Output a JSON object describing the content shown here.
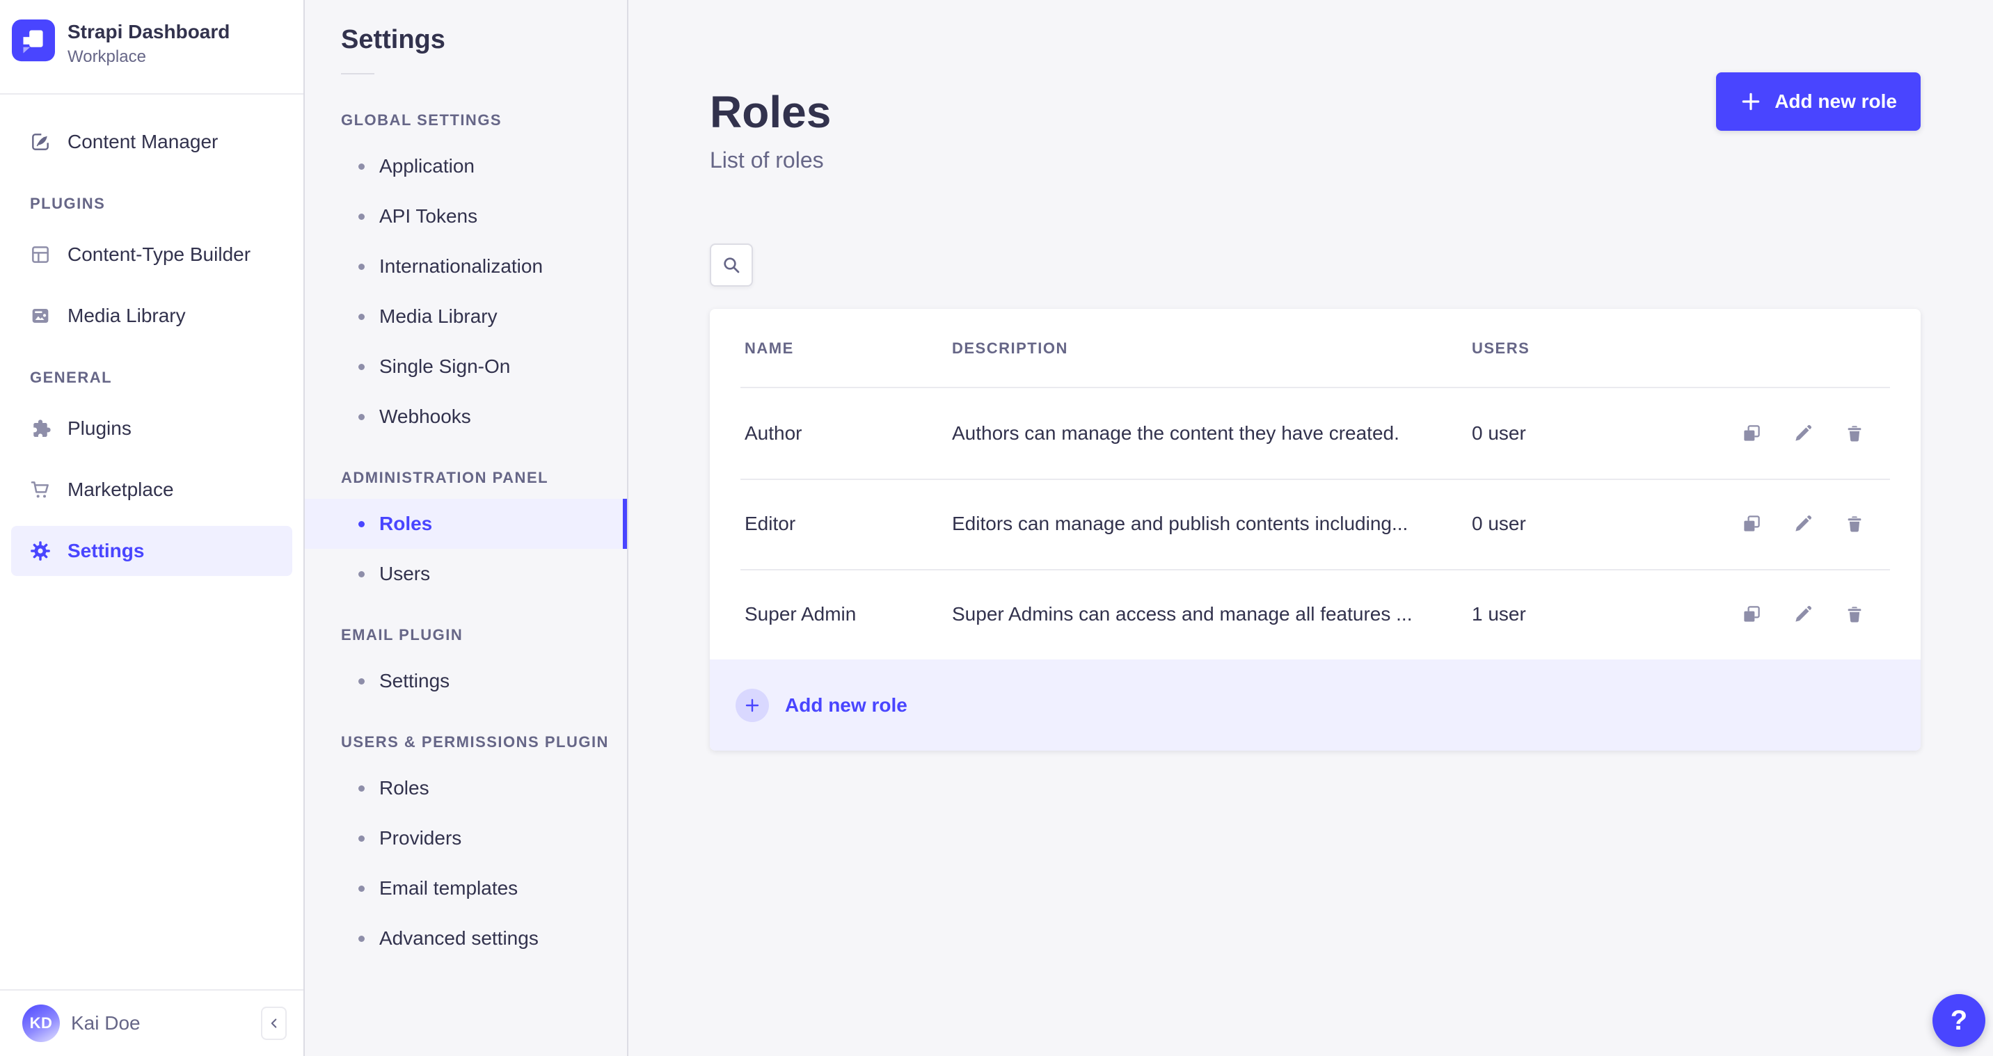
{
  "brand": {
    "name": "Strapi Dashboard",
    "workspace": "Workplace"
  },
  "main_nav": {
    "content_manager": "Content Manager",
    "sections": [
      {
        "title": "Plugins",
        "items": [
          {
            "label": "Content-Type Builder"
          },
          {
            "label": "Media Library"
          }
        ]
      },
      {
        "title": "General",
        "items": [
          {
            "label": "Plugins"
          },
          {
            "label": "Marketplace"
          },
          {
            "label": "Settings",
            "active": true
          }
        ]
      }
    ],
    "user": {
      "initials": "KD",
      "name": "Kai Doe"
    }
  },
  "settings_nav": {
    "title": "Settings",
    "sections": [
      {
        "title": "Global Settings",
        "items": [
          "Application",
          "API Tokens",
          "Internationalization",
          "Media Library",
          "Single Sign-On",
          "Webhooks"
        ]
      },
      {
        "title": "Administration Panel",
        "items": [
          "Roles",
          "Users"
        ],
        "active_item": "Roles"
      },
      {
        "title": "Email Plugin",
        "items": [
          "Settings"
        ]
      },
      {
        "title": "Users & Permissions plugin",
        "items": [
          "Roles",
          "Providers",
          "Email templates",
          "Advanced settings"
        ]
      }
    ]
  },
  "page": {
    "title": "Roles",
    "subtitle": "List of roles",
    "add_button_label": "Add new role",
    "table": {
      "columns": [
        "Name",
        "Description",
        "Users"
      ],
      "rows": [
        {
          "name": "Author",
          "description": "Authors can manage the content they have created.",
          "users": "0 user"
        },
        {
          "name": "Editor",
          "description": "Editors can manage and publish contents including...",
          "users": "0 user"
        },
        {
          "name": "Super Admin",
          "description": "Super Admins can access and manage all features ...",
          "users": "1 user"
        }
      ]
    },
    "footer_add_label": "Add new role",
    "help_label": "?"
  },
  "colors": {
    "primary": "#4945ff",
    "primary_light_bg": "#f0f0ff",
    "text_dark": "#32324d",
    "text_gray": "#666687",
    "icon_gray": "#8e8ea9",
    "border": "#dcdce4",
    "divider": "#eaeaef",
    "page_bg": "#f6f6f9"
  }
}
